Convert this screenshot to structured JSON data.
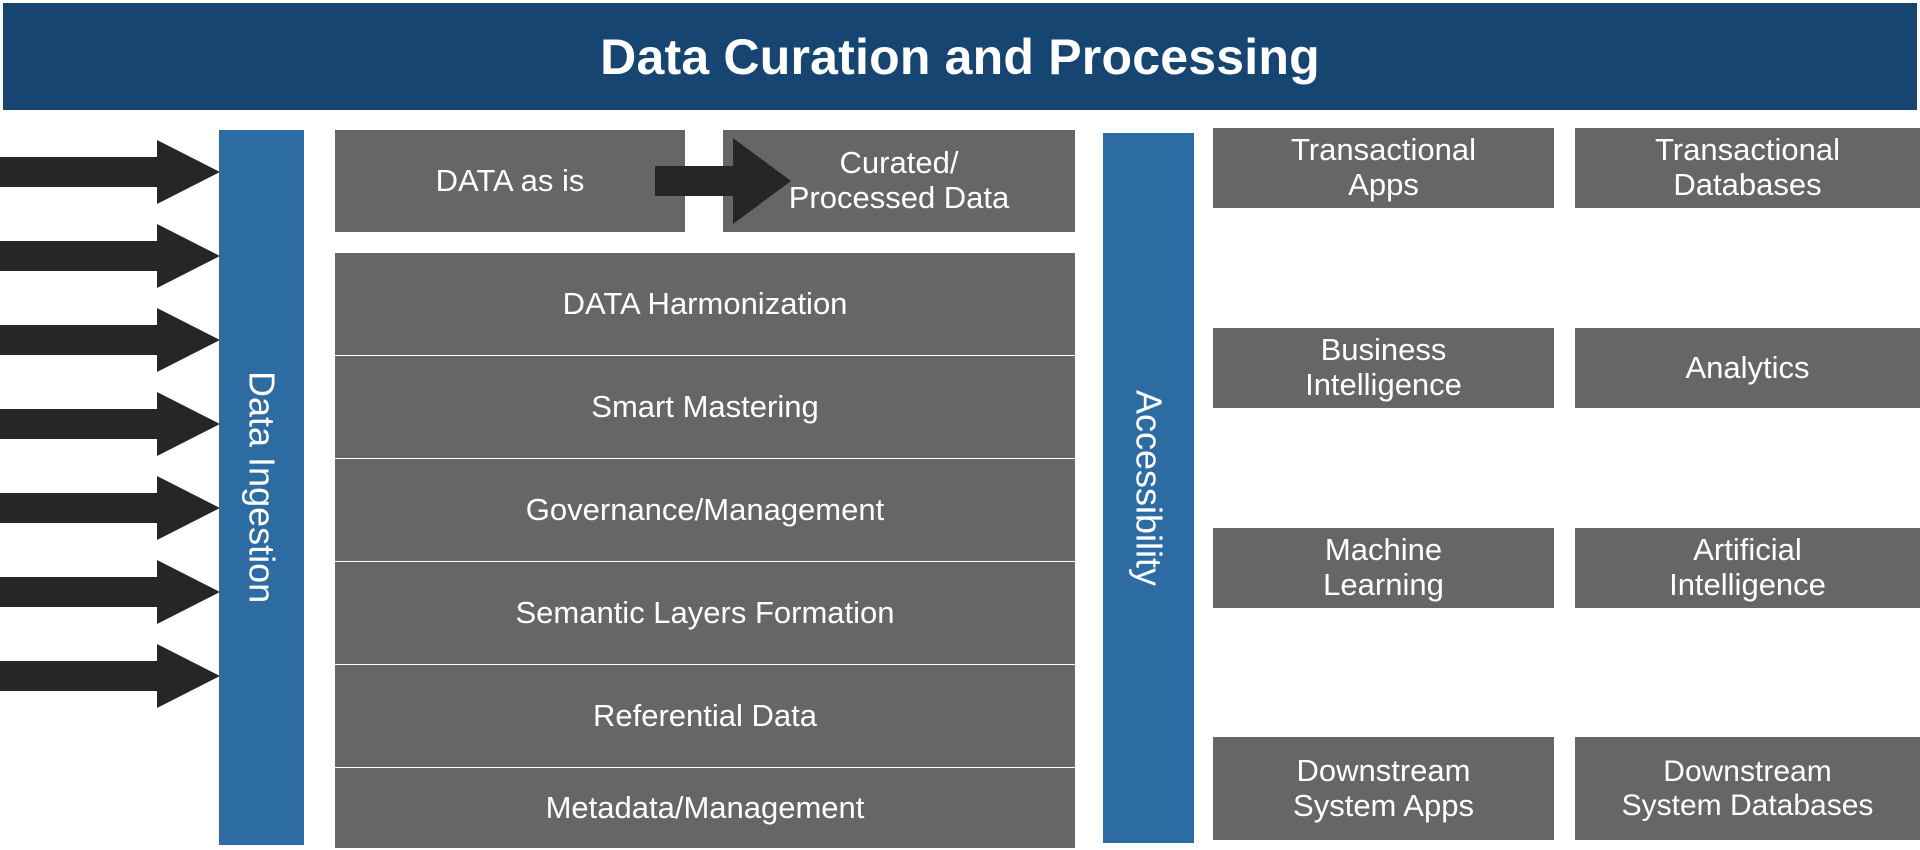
{
  "header": {
    "title": "Data Curation and Processing",
    "bg_color": "#154570",
    "text_color": "#ffffff"
  },
  "colors": {
    "header_blue": "#154570",
    "bar_blue": "#2d6ca2",
    "box_gray": "#666666",
    "arrow_black": "#262626",
    "text_white": "#ffffff",
    "page_white": "#ffffff"
  },
  "ingestion": {
    "bar_label": "Data Ingestion",
    "arrow_count": 7,
    "arrow_icon": "right-arrow-icon",
    "arrow_tops": [
      140,
      224,
      308,
      392,
      476,
      560,
      644
    ]
  },
  "pipeline": {
    "flow_arrow_icon": "right-arrow-icon",
    "top_row": {
      "source_label": "DATA as is",
      "target_label": "Curated/\nProcessed Data"
    },
    "stages": [
      "DATA Harmonization",
      "Smart Mastering",
      "Governance/Management",
      "Semantic Layers Formation",
      "Referential Data",
      "Metadata/Management"
    ]
  },
  "accessibility": {
    "bar_label": "Accessibility",
    "rows": [
      {
        "left": "Transactional\nApps",
        "right": "Transactional\nDatabases"
      },
      {
        "left": "Business\nIntelligence",
        "right": "Analytics"
      },
      {
        "left": "Machine\nLearning",
        "right": "Artificial\nIntelligence"
      },
      {
        "left": "Downstream\nSystem Apps",
        "right": "Downstream\nSystem Databases"
      }
    ]
  }
}
